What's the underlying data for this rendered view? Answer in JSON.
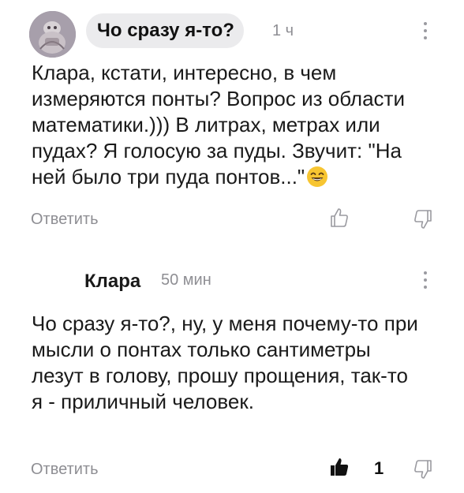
{
  "comments": [
    {
      "author": "Чо сразу я-то?",
      "time": "1 ч",
      "text": "Клара, кстати, интересно, в чем измеряются понты? Вопрос из области математики.))) В литрах, метрах или пудах? Я голосую за пуды. Звучит: \"На ней было три пуда понтов...\"",
      "emoji": "smiling-face-emoji",
      "reply_label": "Ответить",
      "likes": null
    },
    {
      "author": "Клара",
      "time": "50 мин",
      "text": "Чо сразу я-то?, ну, у меня почему-то при мысли о понтах только сантиметры лезут в голову, прошу прощения, так-то я - приличный человек.",
      "reply_label": "Ответить",
      "likes": "1"
    }
  ],
  "colors": {
    "muted": "#8e8e93",
    "chip_bg": "#ebebed",
    "text": "#1a1a1a",
    "emoji": "#f7c531"
  },
  "icons": [
    "menu-dots-icon",
    "thumbs-up-outline-icon",
    "thumbs-down-outline-icon",
    "thumbs-up-filled-icon"
  ]
}
